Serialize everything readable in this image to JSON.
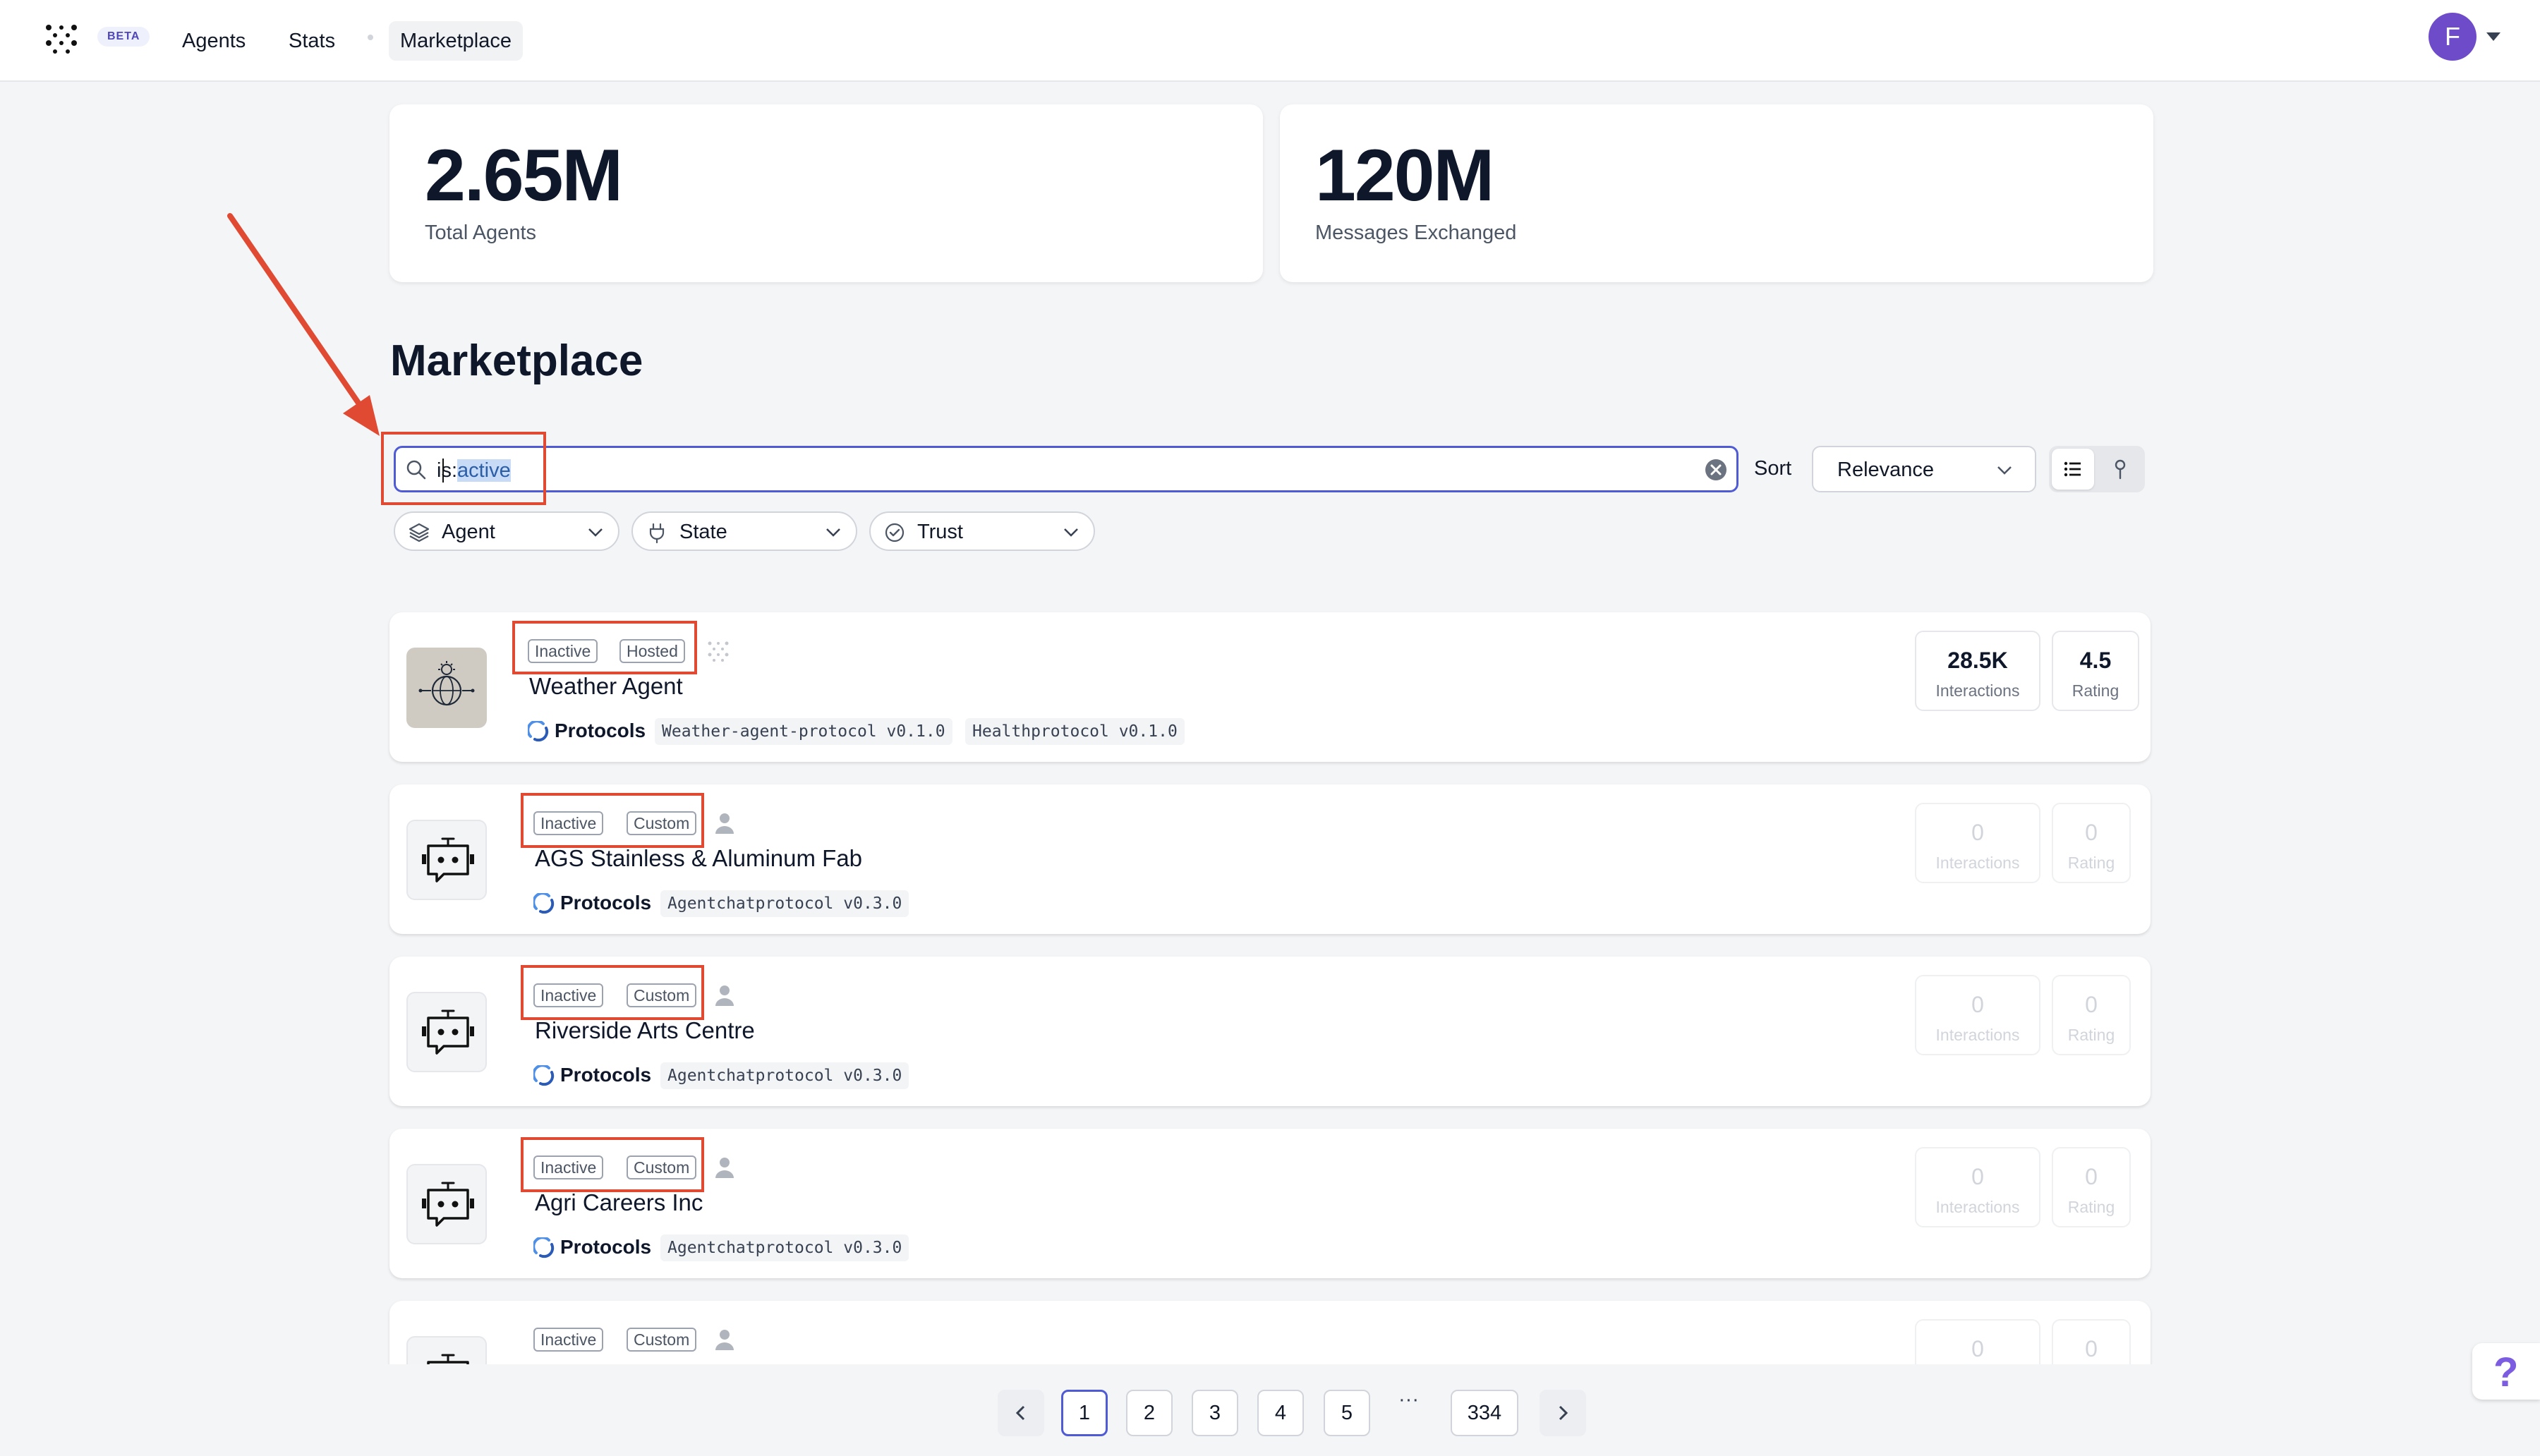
{
  "header": {
    "beta_badge": "BETA",
    "nav": [
      "Agents",
      "Stats",
      "Marketplace"
    ],
    "active_nav": "Marketplace",
    "avatar_initial": "F"
  },
  "stats": [
    {
      "value": "2.65M",
      "label": "Total Agents"
    },
    {
      "value": "120M",
      "label": "Messages Exchanged"
    }
  ],
  "section_title": "Marketplace",
  "search": {
    "prefix": "is:",
    "highlighted": "active"
  },
  "sort": {
    "label": "Sort",
    "value": "Relevance"
  },
  "filters": [
    "Agent",
    "State",
    "Trust"
  ],
  "agents": [
    {
      "tags": [
        "Inactive",
        "Hosted"
      ],
      "name": "Weather Agent",
      "protocols_label": "Protocols",
      "protocols": [
        "Weather-agent-protocol v0.1.0",
        "Healthprotocol v0.1.0"
      ],
      "interactions": "28.5K",
      "interactions_label": "Interactions",
      "rating": "4.5",
      "rating_label": "Rating"
    },
    {
      "tags": [
        "Inactive",
        "Custom"
      ],
      "name": "AGS Stainless & Aluminum Fab",
      "protocols_label": "Protocols",
      "protocols": [
        "Agentchatprotocol v0.3.0"
      ],
      "interactions": "0",
      "interactions_label": "Interactions",
      "rating": "0",
      "rating_label": "Rating"
    },
    {
      "tags": [
        "Inactive",
        "Custom"
      ],
      "name": "Riverside Arts Centre",
      "protocols_label": "Protocols",
      "protocols": [
        "Agentchatprotocol v0.3.0"
      ],
      "interactions": "0",
      "interactions_label": "Interactions",
      "rating": "0",
      "rating_label": "Rating"
    },
    {
      "tags": [
        "Inactive",
        "Custom"
      ],
      "name": "Agri Careers Inc",
      "protocols_label": "Protocols",
      "protocols": [
        "Agentchatprotocol v0.3.0"
      ],
      "interactions": "0",
      "interactions_label": "Interactions",
      "rating": "0",
      "rating_label": "Rating"
    },
    {
      "tags": [
        "Inactive",
        "Custom"
      ],
      "interactions": "0",
      "rating": "0"
    }
  ],
  "pagination": {
    "pages": [
      "1",
      "2",
      "3",
      "4",
      "5"
    ],
    "ellipsis": "···",
    "last": "334",
    "current": "1"
  },
  "help_label": "?",
  "colors": {
    "accent": "#4f5bd5",
    "annotation_red": "#e04a32",
    "avatar": "#6d4bc9"
  }
}
